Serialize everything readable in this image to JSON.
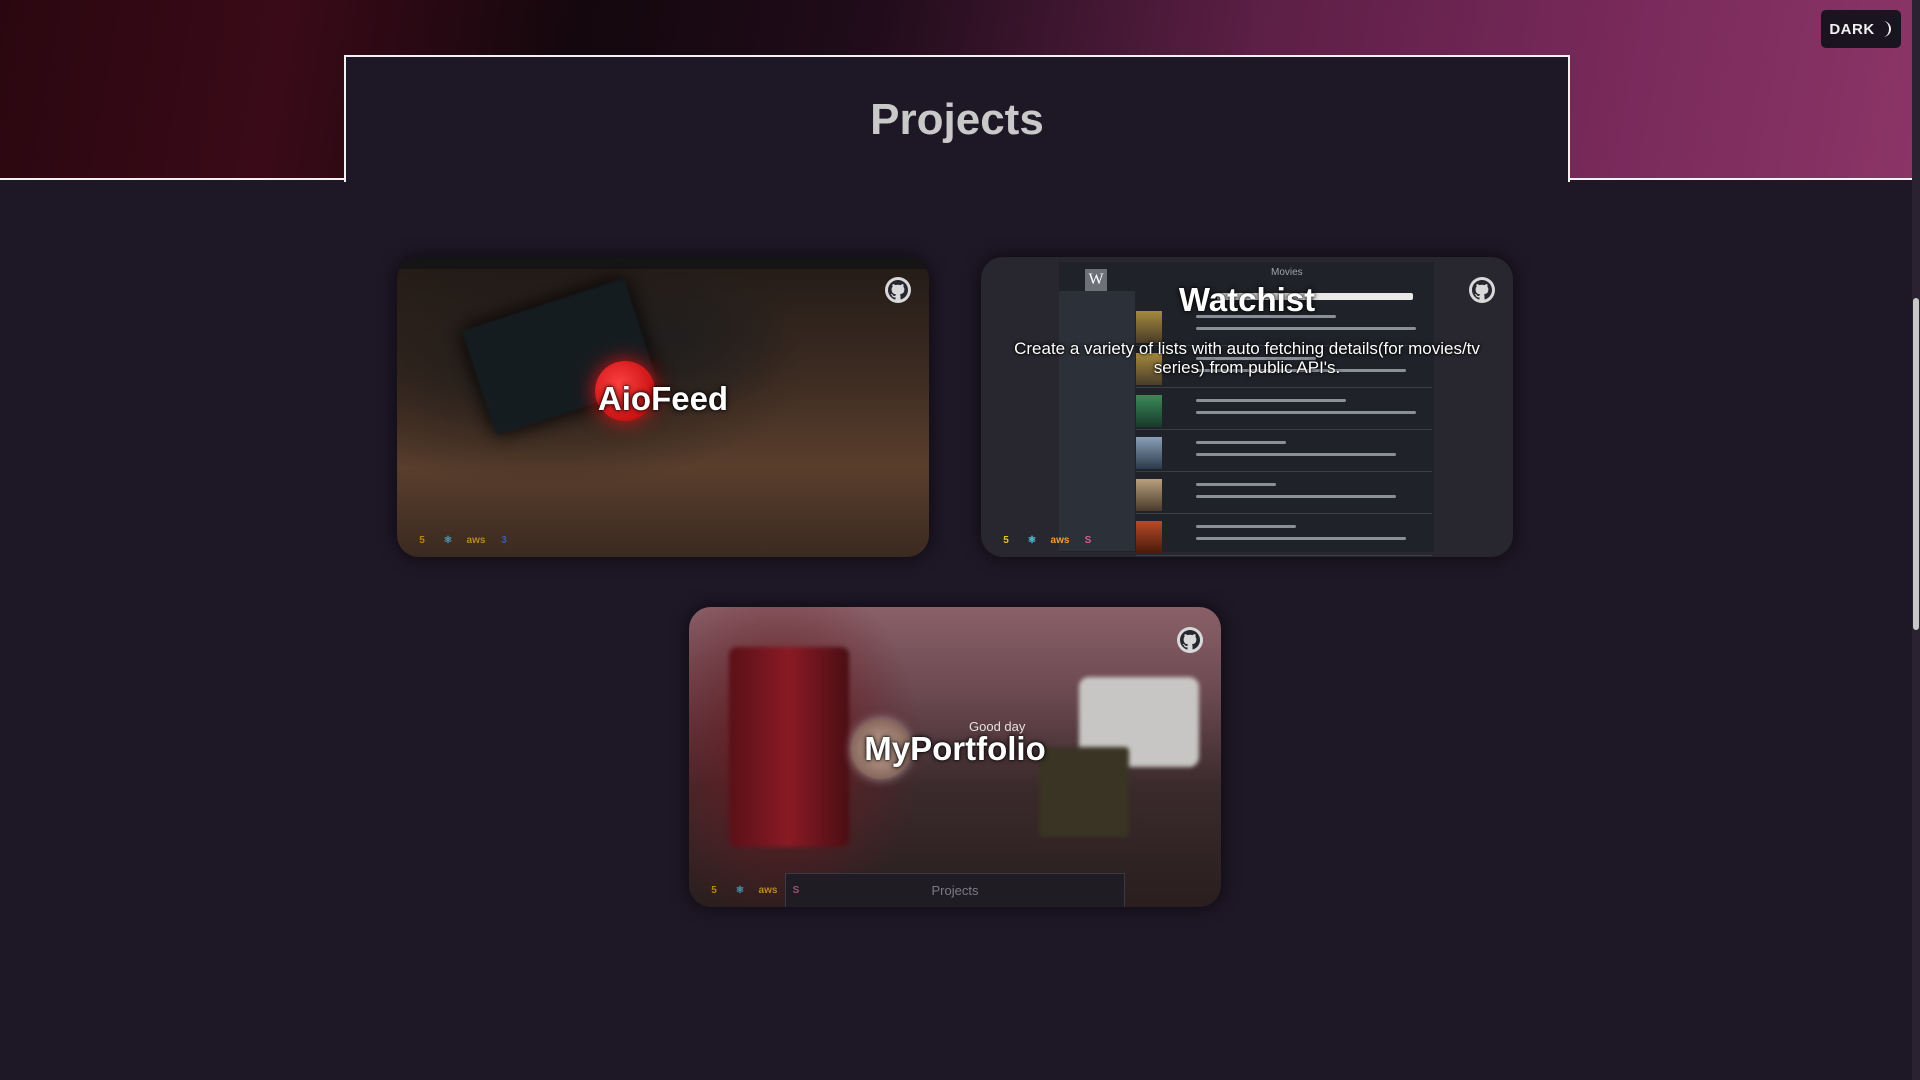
{
  "page": {
    "section_title": "Projects"
  },
  "theme_toggle": {
    "label": "DARK"
  },
  "projects": [
    {
      "name": "AioFeed",
      "description": "",
      "tech_icons": [
        "html5-icon",
        "react-icon",
        "aws-icon",
        "css3-icon"
      ]
    },
    {
      "name": "Watchist",
      "description": "Create a variety of lists with auto fetching details(for movies/tv series) from public API's.",
      "screenshot_title": "Movies",
      "tech_icons": [
        "html5-icon",
        "react-icon",
        "aws-icon",
        "sass-icon"
      ]
    },
    {
      "name": "MyPortfolio",
      "description": "",
      "greeting": "Good day",
      "panel_label": "Projects",
      "tech_icons": [
        "html5-icon",
        "react-icon",
        "aws-icon",
        "sass-icon"
      ]
    }
  ],
  "colors": {
    "background": "#1e1726",
    "title_text": "#c9c9c9",
    "border": "#f2f2f2",
    "hero_accent": "#7a2a5c"
  }
}
